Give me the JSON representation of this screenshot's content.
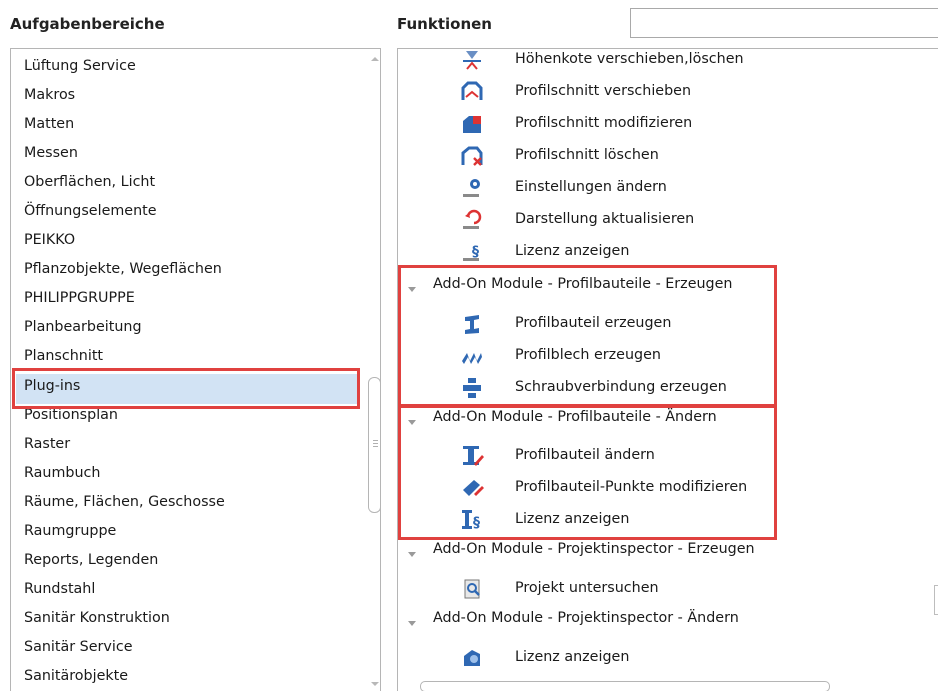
{
  "left_header": "Aufgabenbereiche",
  "right_header": "Funktionen",
  "search": {
    "value": "",
    "icon": "magnifier-icon"
  },
  "left_list": {
    "items": [
      "Lüftung Service",
      "Makros",
      "Matten",
      "Messen",
      "Oberflächen, Licht",
      "Öffnungselemente",
      "PEIKKO",
      "Pflanzobjekte, Wegeflächen",
      "PHILIPPGRUPPE",
      "Planbearbeitung",
      "Planschnitt",
      "Plug-ins",
      "Positionsplan",
      "Raster",
      "Raumbuch",
      "Räume, Flächen, Geschosse",
      "Raumgruppe",
      "Reports, Legenden",
      "Rundstahl",
      "Sanitär Konstruktion",
      "Sanitär Service",
      "Sanitärobjekte"
    ],
    "selected": "Plug-ins"
  },
  "tree": {
    "top_functions": [
      {
        "label": "Höhenkote verschieben,löschen",
        "icon": "height-marker-icon"
      },
      {
        "label": "Profilschnitt verschieben",
        "icon": "section-move-icon"
      },
      {
        "label": "Profilschnitt modifizieren",
        "icon": "section-modify-icon"
      },
      {
        "label": "Profilschnitt löschen",
        "icon": "section-delete-icon"
      },
      {
        "label": "Einstellungen ändern",
        "icon": "settings-gear-icon"
      },
      {
        "label": "Darstellung aktualisieren",
        "icon": "refresh-icon"
      },
      {
        "label": "Lizenz anzeigen",
        "icon": "license-icon"
      }
    ],
    "groups": [
      {
        "label": "Add-On Module - Profilbauteile - Erzeugen",
        "items": [
          {
            "label": "Profilbauteil erzeugen",
            "icon": "steel-profile-icon"
          },
          {
            "label": "Profilblech erzeugen",
            "icon": "profile-sheet-icon"
          },
          {
            "label": "Schraubverbindung erzeugen",
            "icon": "bolt-connection-icon"
          }
        ]
      },
      {
        "label": "Add-On Module - Profilbauteile - Ändern",
        "items": [
          {
            "label": "Profilbauteil ändern",
            "icon": "profile-edit-icon"
          },
          {
            "label": "Profilbauteil-Punkte modifizieren",
            "icon": "profile-points-icon"
          },
          {
            "label": "Lizenz anzeigen",
            "icon": "profile-license-icon"
          }
        ]
      },
      {
        "label": "Add-On Module - Projektinspector - Erzeugen",
        "items": [
          {
            "label": "Projekt untersuchen",
            "icon": "project-inspect-icon"
          }
        ]
      },
      {
        "label": "Add-On Module - Projektinspector - Ändern",
        "items": [
          {
            "label": "Lizenz anzeigen",
            "icon": "inspector-license-icon"
          }
        ]
      }
    ]
  },
  "colors": {
    "highlight_red": "#e0413f",
    "selection_blue": "#d2e3f4",
    "icon_blue": "#2f68b3"
  }
}
